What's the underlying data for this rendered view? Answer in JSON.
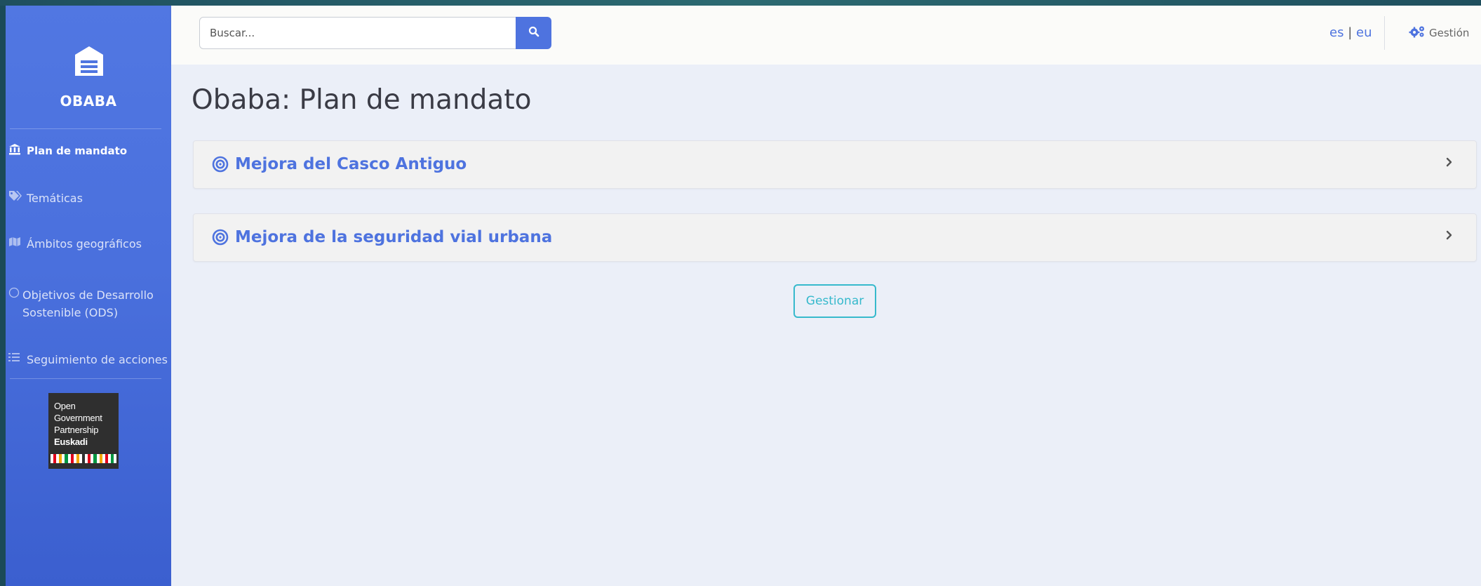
{
  "app": {
    "name": "OBABA"
  },
  "sidebar": {
    "items": [
      {
        "label": "Plan de mandato",
        "icon": "landmark-icon",
        "active": true
      },
      {
        "label": "Temáticas",
        "icon": "tags-icon",
        "active": false
      },
      {
        "label": "Ámbitos geográficos",
        "icon": "map-icon",
        "active": false
      },
      {
        "label": "Objetivos de Desarrollo Sostenible (ODS)",
        "icon": "circle-icon",
        "active": false
      },
      {
        "label": "Seguimiento de acciones",
        "icon": "list-icon",
        "active": false
      }
    ],
    "partner_logo": {
      "line1": "Open",
      "line2": "Government",
      "line3": "Partnership",
      "line4": "Euskadi"
    }
  },
  "topbar": {
    "search": {
      "placeholder": "Buscar...",
      "value": ""
    },
    "languages": [
      "es",
      "eu"
    ],
    "language_separator": "|",
    "gestion_label": "Gestión"
  },
  "main": {
    "title": "Obaba: Plan de mandato",
    "items": [
      {
        "label": "Mejora del Casco Antiguo"
      },
      {
        "label": "Mejora de la seguridad vial urbana"
      }
    ],
    "manage_button": "Gestionar"
  },
  "colors": {
    "primary": "#4e73df",
    "info": "#36b9cc",
    "sidebar_top": "#5177e2",
    "sidebar_bottom": "#3b5fcf",
    "content_bg": "#ebeff8"
  }
}
